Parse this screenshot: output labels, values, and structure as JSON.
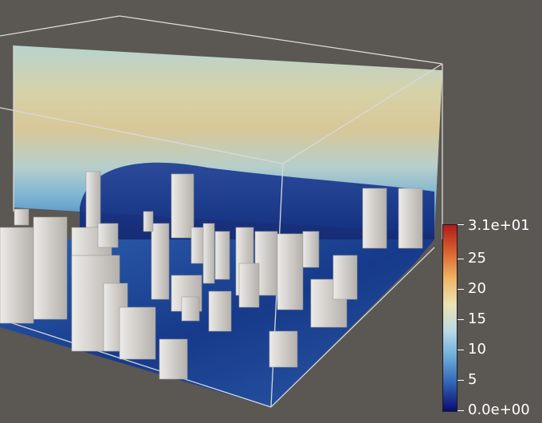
{
  "legend": {
    "max_label": "3.1e+01",
    "ticks": [
      "25",
      "20",
      "15",
      "10",
      "5"
    ],
    "min_label": "0.0e+00",
    "colormap": [
      "#0b0c6e",
      "#2f5fb3",
      "#69a9d8",
      "#b9d8e6",
      "#ebe2b2",
      "#f0b466",
      "#d8622f",
      "#b11a1a"
    ]
  },
  "scene": {
    "background": "#5b5753",
    "outline_color": "#d9d9d9",
    "building_color": "#d6d3cf",
    "ground_color": "#1f3f8a"
  }
}
